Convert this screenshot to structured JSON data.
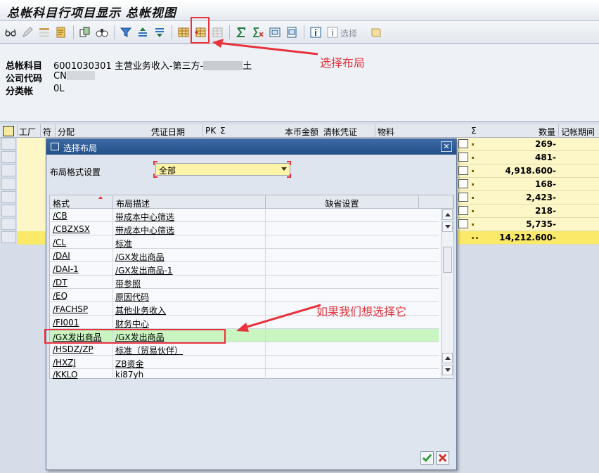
{
  "window": {
    "title": "总帐科目行项目显示 总帐视图"
  },
  "toolbar": {
    "select_label": "选择"
  },
  "header": {
    "fields": [
      {
        "label": "总帐科目",
        "value": "6001030301 主营业务收入-第三方-",
        "suffix": "土"
      },
      {
        "label": "公司代码",
        "value": "CN"
      },
      {
        "label": "分类帐",
        "value": "0L"
      }
    ]
  },
  "annotations": {
    "choose_layout": "选择布局",
    "if_we_want": "如果我们想选择它"
  },
  "grid": {
    "columns": [
      "工厂",
      "符",
      "分配",
      "凭证日期",
      "PK",
      "Σ",
      "本币金额",
      "清帐凭证",
      "物料",
      "Σ",
      "数量",
      "记帐期间"
    ],
    "quantities": [
      "269-",
      "481-",
      "4,918.600-",
      "168-",
      "2,423-",
      "218-",
      "5,735-"
    ],
    "total": "14,212.600-"
  },
  "dialog": {
    "title": "选择布局",
    "filter_label": "布局格式设置",
    "filter_value": "全部",
    "table": {
      "headers": [
        "格式",
        "布局描述",
        "缺省设置"
      ],
      "rows": [
        {
          "format": "/CB",
          "desc": "带成本中心筛选"
        },
        {
          "format": "/CBZXSX",
          "desc": "带成本中心筛选"
        },
        {
          "format": "/CL",
          "desc": "标准"
        },
        {
          "format": "/DAI",
          "desc": "/GX发出商品"
        },
        {
          "format": "/DAI-1",
          "desc": "/GX发出商品-1"
        },
        {
          "format": "/DT",
          "desc": "带参照"
        },
        {
          "format": "/EQ",
          "desc": "原因代码"
        },
        {
          "format": "/FACHSP",
          "desc": "其他业务收入"
        },
        {
          "format": "/FI001",
          "desc": "财务中心"
        },
        {
          "format": "/GX发出商品",
          "desc": "/GX发出商品"
        },
        {
          "format": "/HSDZ/ZP",
          "desc": "标准（贸易伙伴）"
        },
        {
          "format": "/HXZJ",
          "desc": "ZB资金"
        },
        {
          "format": "/KKLO",
          "desc": "ki87yh"
        }
      ]
    }
  },
  "colors": {
    "accent_red": "#e8323c",
    "selected_row": "#c8f5c0",
    "highlight_yellow": "#fdf6c6"
  }
}
